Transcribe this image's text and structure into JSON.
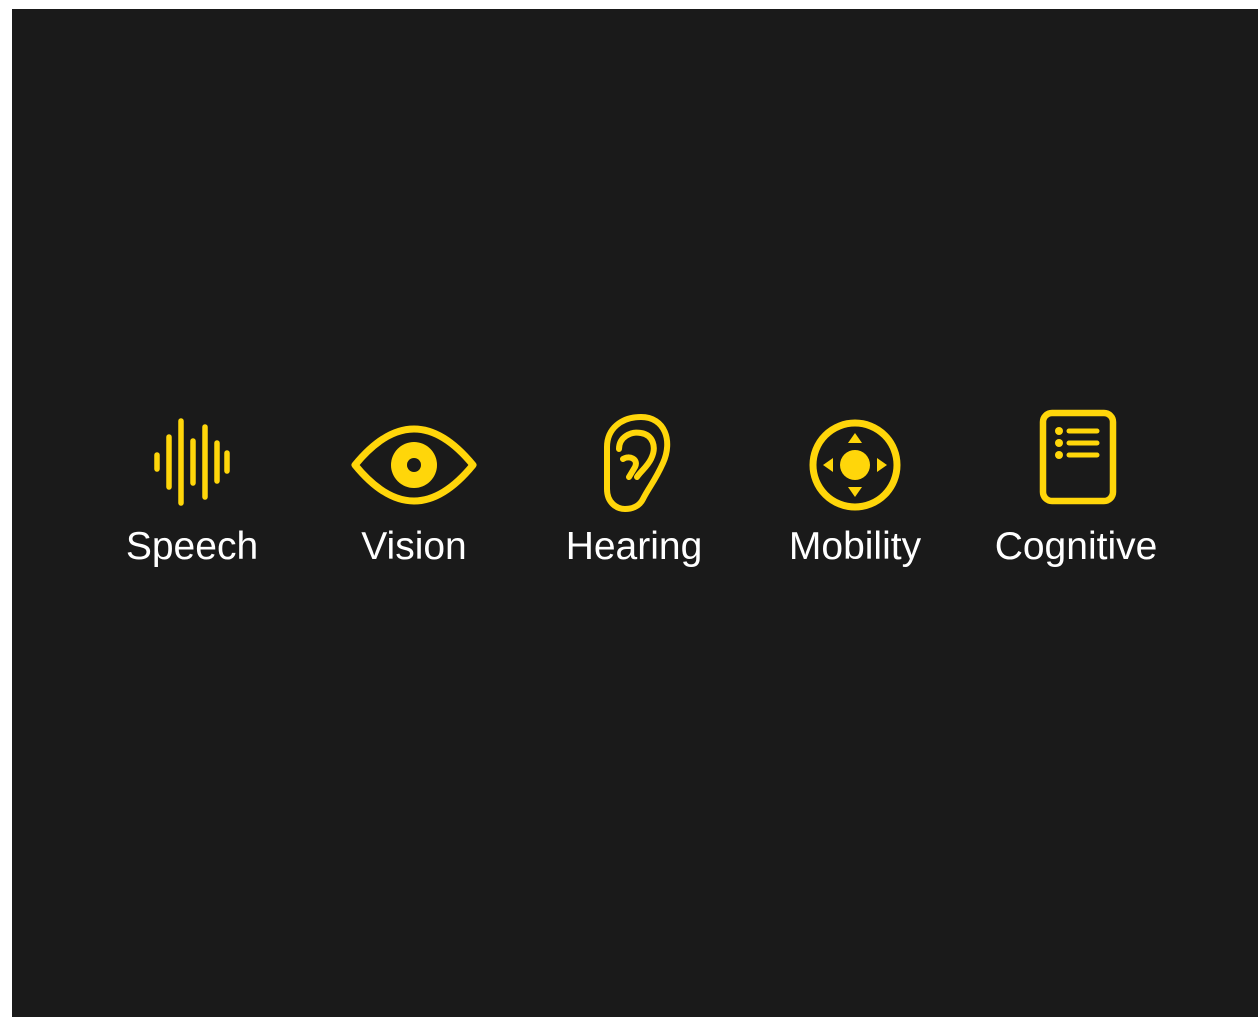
{
  "colors": {
    "background": "#1a1a1a",
    "accent": "#ffd60a",
    "label": "#ffffff"
  },
  "categories": [
    {
      "label": "Speech",
      "icon": "waveform-icon"
    },
    {
      "label": "Vision",
      "icon": "eye-icon"
    },
    {
      "label": "Hearing",
      "icon": "ear-icon"
    },
    {
      "label": "Mobility",
      "icon": "directional-pad-icon"
    },
    {
      "label": "Cognitive",
      "icon": "list-icon"
    }
  ]
}
